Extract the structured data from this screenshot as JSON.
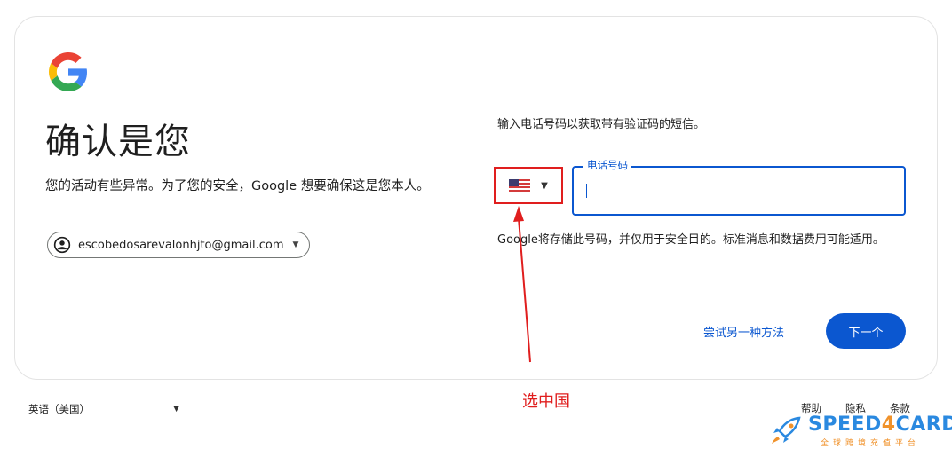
{
  "brand": {
    "logo_icon": "google-g-logo-icon",
    "colors": {
      "blue": "#4285F4",
      "red": "#EA4335",
      "yellow": "#FBBC05",
      "green": "#34A853"
    }
  },
  "left": {
    "title": "确认是您",
    "subtitle": "您的活动有些异常。为了您的安全，Google 想要确保这是您本人。",
    "account": {
      "avatar_icon": "account-circle-icon",
      "email": "escobedosarevalonhjto@gmail.com",
      "caret_icon": "caret-down-icon"
    }
  },
  "right": {
    "prompt": "输入电话号码以获取带有验证码的短信。",
    "country": {
      "flag_icon": "us-flag-icon",
      "caret_icon": "caret-down-icon"
    },
    "phone": {
      "label": "电话号码",
      "value": ""
    },
    "disclaimer": "Google将存储此号码，并仅用于安全目的。标准消息和数据费用可能适用。",
    "try_another": "尝试另一种方法",
    "next": "下一个"
  },
  "annotation": {
    "text": "选中国",
    "color": "#e01e1e"
  },
  "footer": {
    "language": "英语（美国）",
    "links": [
      "帮助",
      "隐私",
      "条款"
    ]
  },
  "watermark": {
    "word_a": "SPEED",
    "word_b": "4",
    "word_c": "CARD",
    "subtitle": "全球跨境充值平台",
    "icon": "rocket-icon"
  },
  "accent": {
    "primary": "#0b57d0"
  }
}
